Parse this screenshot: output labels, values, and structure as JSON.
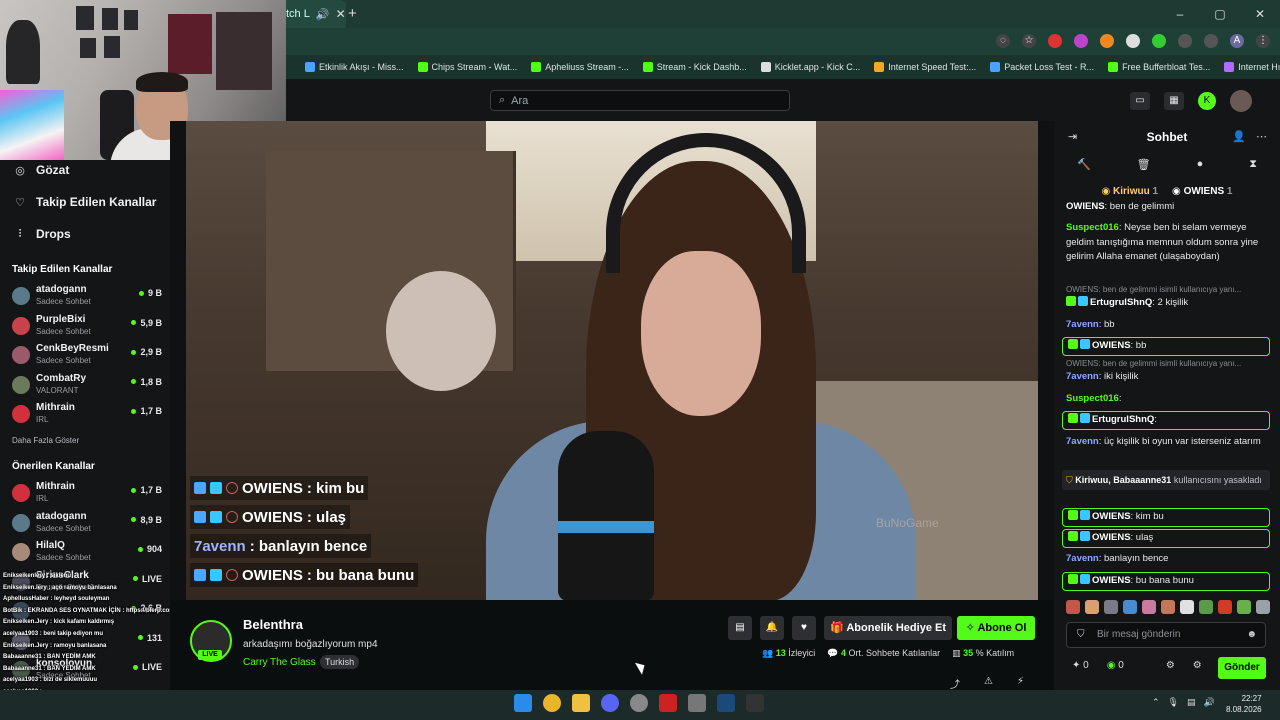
{
  "browser": {
    "tab_title": "tch L",
    "bookmarks": [
      {
        "label": "Etkinlik Akışı - Miss...",
        "color": "#4aa3ff"
      },
      {
        "label": "Chips Stream - Wat...",
        "color": "#53fc18"
      },
      {
        "label": "Apheliuss Stream -...",
        "color": "#53fc18"
      },
      {
        "label": "Stream - Kick Dashb...",
        "color": "#53fc18"
      },
      {
        "label": "Kicklet.app - Kick C...",
        "color": "#dddddd"
      },
      {
        "label": "Internet Speed Test:...",
        "color": "#f5a623"
      },
      {
        "label": "Packet Loss Test - R...",
        "color": "#4aa3ff"
      },
      {
        "label": "Free Bufferbloat Tes...",
        "color": "#53fc18"
      },
      {
        "label": "Internet Hız Testi &...",
        "color": "#b36bff"
      }
    ]
  },
  "header": {
    "search_placeholder": "Ara"
  },
  "sidebar": {
    "nav": [
      {
        "label": "Gözat",
        "icon": "compass-icon"
      },
      {
        "label": "Takip Edilen Kanallar",
        "icon": "heart-icon"
      },
      {
        "label": "Drops",
        "icon": "drops-icon"
      }
    ],
    "following_heading": "Takip Edilen Kanallar",
    "following": [
      {
        "name": "atadogann",
        "game": "Sadece Sohbet",
        "viewers": "9 B",
        "color": "#5a7a8a"
      },
      {
        "name": "PurpleBixi",
        "game": "Sadece Sohbet",
        "viewers": "5,9 B",
        "color": "#c8424a"
      },
      {
        "name": "CenkBeyResmi",
        "game": "Sadece Sohbet",
        "viewers": "2,9 B",
        "color": "#9a5a6a"
      },
      {
        "name": "CombatRy",
        "game": "VALORANT",
        "viewers": "1,8 B",
        "color": "#6a7a5a"
      },
      {
        "name": "Mithrain",
        "game": "IRL",
        "viewers": "1,7 B",
        "color": "#d0313d"
      }
    ],
    "more_label": "Daha Fazla Göster",
    "recommended_heading": "Önerilen Kanallar",
    "recommended": [
      {
        "name": "Mithrain",
        "game": "IRL",
        "viewers": "1,7 B",
        "color": "#d0313d"
      },
      {
        "name": "atadogann",
        "game": "Sadece Sohbet",
        "viewers": "8,9 B",
        "color": "#5a7a8a"
      },
      {
        "name": "HilalQ",
        "game": "Sadece Sohbet",
        "viewers": "904",
        "color": "#a88a7a"
      },
      {
        "name": "SiriusClark",
        "game": "Counter-Strike 2",
        "viewers": "LIVE",
        "color": "#4a4a5a"
      },
      {
        "name": "",
        "game": "",
        "viewers": "2,6 B",
        "color": "#3a4a5a"
      },
      {
        "name": "",
        "game": "",
        "viewers": "131",
        "color": "#5a5a6a"
      },
      {
        "name": "konsolovun",
        "game": "Sadece Sohbet",
        "viewers": "LIVE",
        "color": "#4a5a4a"
      }
    ]
  },
  "overlay_chat": [
    "Enikseikenlery : sikienu",
    "Enikseiken.lery : açö ramoyu banlasana",
    "AphelIussHaber : leyheyd souleyman",
    "BotBik : EKRANDA SES OYNATMAK İÇİN : https://blerp.com/x/aphelius",
    "Enikseiken.Jery : kick kafamı kaldırmış",
    "acelyaa1903 : beni takip ediyon mu",
    "Enikseiken.Jery : ramoyu banlasana",
    "Babaaanne31 : BAN YEDİM AMK",
    "Babaaanne31 : BAN YEDIM AMK",
    "acelyaa1903 : bizi de siklemuuuu",
    "acelyaa1903 :"
  ],
  "stream_chat": [
    {
      "user": "OWIENS",
      "text": ": kim bu",
      "badges": true
    },
    {
      "user": "OWIENS",
      "text": ": ulaş",
      "badges": true
    },
    {
      "user": "7avenn",
      "text": ": banlayın bence",
      "badges": false
    },
    {
      "user": "OWIENS",
      "text": ": bu bana bunu",
      "badges": true
    }
  ],
  "video": {
    "watermark": "BuNoGame"
  },
  "stream": {
    "streamer": "Belenthra",
    "live_label": "LIVE",
    "title": "arkadaşımı boğazlıyorum mp4",
    "category": "Carry The Glass",
    "tag": "Turkish",
    "gift_label": "Abonelik Hediye Et",
    "subscribe_label": "Abone Ol",
    "viewers": "13",
    "viewers_label": "İzleyici",
    "avg_chatters": "4",
    "avg_chatters_label": "Ort. Sohbete Katılanlar",
    "participation": "35",
    "participation_label": "% Katılım"
  },
  "chat": {
    "title": "Sohbet",
    "pinned": [
      {
        "name": "Kiriwuu",
        "count": "1"
      },
      {
        "name": "OWIENS",
        "count": "1"
      }
    ],
    "messages": [
      {
        "kind": "plain",
        "user": "OWIENS",
        "text": ": ben de gelimmi",
        "cls": "u-w"
      },
      {
        "kind": "plain",
        "user": "Suspect016",
        "text": ": Neyse ben bi selam vermeye geldim tanıştığıma memnun oldum sonra yine gelirim Allaha emanet (ulaşaboydan)",
        "cls": "u-g"
      },
      {
        "kind": "reply",
        "reply": "OWIENS: ben de gelimmi isimli kullanıcıya yanı...",
        "user": "ErtugrulShnQ",
        "text": ": 2 kişilik",
        "cls": "u-w"
      },
      {
        "kind": "plain",
        "user": "7avenn",
        "text": ": bb",
        "cls": "u-b"
      },
      {
        "kind": "box",
        "user": "OWIENS",
        "text": ": bb",
        "cls": "u-w"
      },
      {
        "kind": "reply2",
        "reply": "OWIENS: ben de gelimmi isimli kullanıcıya yanı...",
        "user": "7avenn",
        "text": ": iki kişilik",
        "cls": "u-b"
      },
      {
        "kind": "plain",
        "user": "Suspect016",
        "text": ":",
        "cls": "u-g"
      },
      {
        "kind": "box",
        "user": "ErtugrulShnQ",
        "text": ":",
        "cls": "u-w"
      },
      {
        "kind": "plain",
        "user": "7avenn",
        "text": ": üç kişilik bi oyun var isterseniz atarım",
        "cls": "u-b"
      },
      {
        "kind": "box",
        "user": "OWIENS",
        "text": ": kim bu",
        "cls": "u-w"
      },
      {
        "kind": "box",
        "user": "OWIENS",
        "text": ": ulaş",
        "cls": "u-w"
      },
      {
        "kind": "plain",
        "user": "7avenn",
        "text": ": banlayın bence",
        "cls": "u-b"
      },
      {
        "kind": "box",
        "user": "OWIENS",
        "text": ": bu bana bunu",
        "cls": "u-w"
      }
    ],
    "ban_users": "Kiriwuu, Babaaanne31",
    "ban_text": "kullanıcısını yasakladı",
    "input_placeholder": "Bir mesaj gönderin",
    "points_a": "0",
    "points_b": "0",
    "send_label": "Gönder"
  },
  "taskbar": {
    "time": "22:27",
    "date": "8.08.2026"
  },
  "colors": {
    "kick_green": "#53fc18",
    "panel": "#141517"
  }
}
